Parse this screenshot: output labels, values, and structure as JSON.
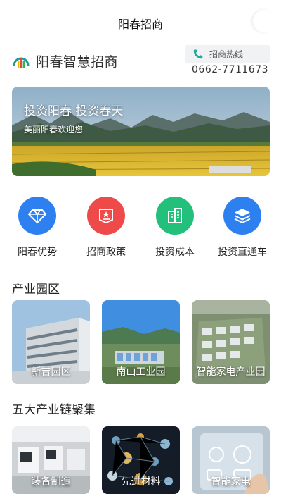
{
  "topbar": {
    "title": "阳春招商"
  },
  "brand": {
    "name": "阳春智慧招商"
  },
  "hotline": {
    "label": "招商热线",
    "number": "0662-7711673"
  },
  "banner": {
    "headline": "投资阳春 投资春天",
    "subline": "美丽阳春欢迎您"
  },
  "quick_links": [
    {
      "label": "阳春优势",
      "icon": "diamond-icon",
      "color": "#2e7ff0"
    },
    {
      "label": "招商政策",
      "icon": "policy-flag-icon",
      "color": "#ee4a4a"
    },
    {
      "label": "投资成本",
      "icon": "building-icon",
      "color": "#22c07a"
    },
    {
      "label": "投资直通车",
      "icon": "layers-icon",
      "color": "#2e7ff0"
    }
  ],
  "parks": {
    "title": "产业园区",
    "items": [
      {
        "label": "新吉园区"
      },
      {
        "label": "南山工业园"
      },
      {
        "label": "智能家电产业园"
      }
    ]
  },
  "industries": {
    "title": "五大产业链聚集",
    "items": [
      {
        "label": "装备制造"
      },
      {
        "label": "先进材料"
      },
      {
        "label": "智能家电"
      }
    ]
  }
}
